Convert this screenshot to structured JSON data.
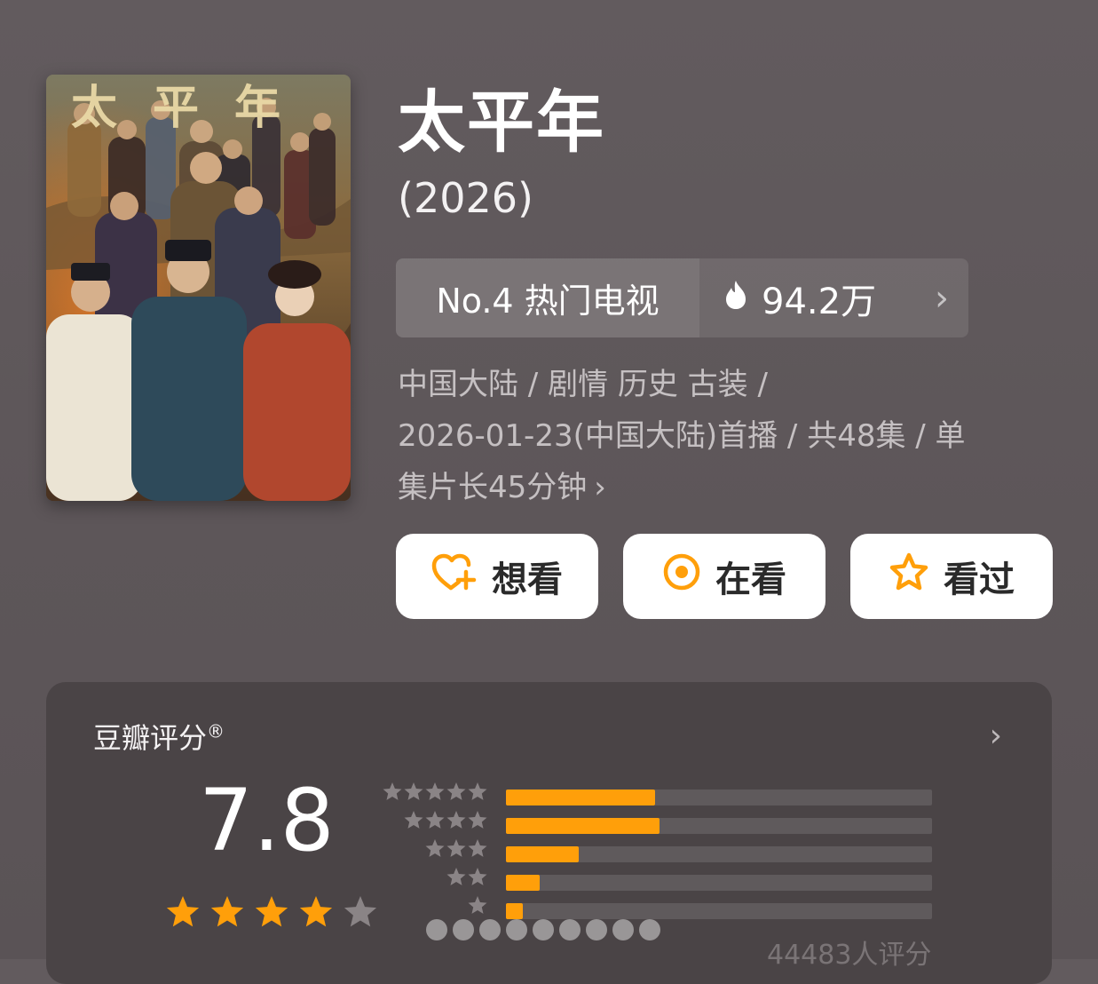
{
  "poster": {
    "title_text": "太平年"
  },
  "show": {
    "title": "太平年",
    "year": "(2026)"
  },
  "rank": {
    "label": "No.4 热门电视",
    "heat": "94.2万",
    "heat_icon": "flame-icon",
    "chevron": "›"
  },
  "meta": {
    "line1": "中国大陆 / 剧情 历史 古装 /",
    "line2": "2026-01-23(中国大陆)首播 / 共48集 / 单",
    "line3": "集片长45分钟",
    "chevron": "›"
  },
  "actions": [
    {
      "label": "想看",
      "icon": "heart-plus-icon"
    },
    {
      "label": "在看",
      "icon": "target-circle-icon"
    },
    {
      "label": "看过",
      "icon": "star-outline-icon"
    }
  ],
  "rating": {
    "label": "豆瓣评分",
    "registered": "®",
    "chevron": "›",
    "score": "7.8",
    "star_level": 4,
    "count": "44483人评分"
  },
  "chart_data": {
    "type": "bar",
    "categories": [
      "5星",
      "4星",
      "3星",
      "2星",
      "1星"
    ],
    "values": [
      35,
      36,
      17,
      8,
      4
    ],
    "ylim": [
      0,
      100
    ]
  },
  "colors": {
    "accent": "#ff9f0a",
    "card": "#4a4446",
    "background": "#5f585b"
  }
}
